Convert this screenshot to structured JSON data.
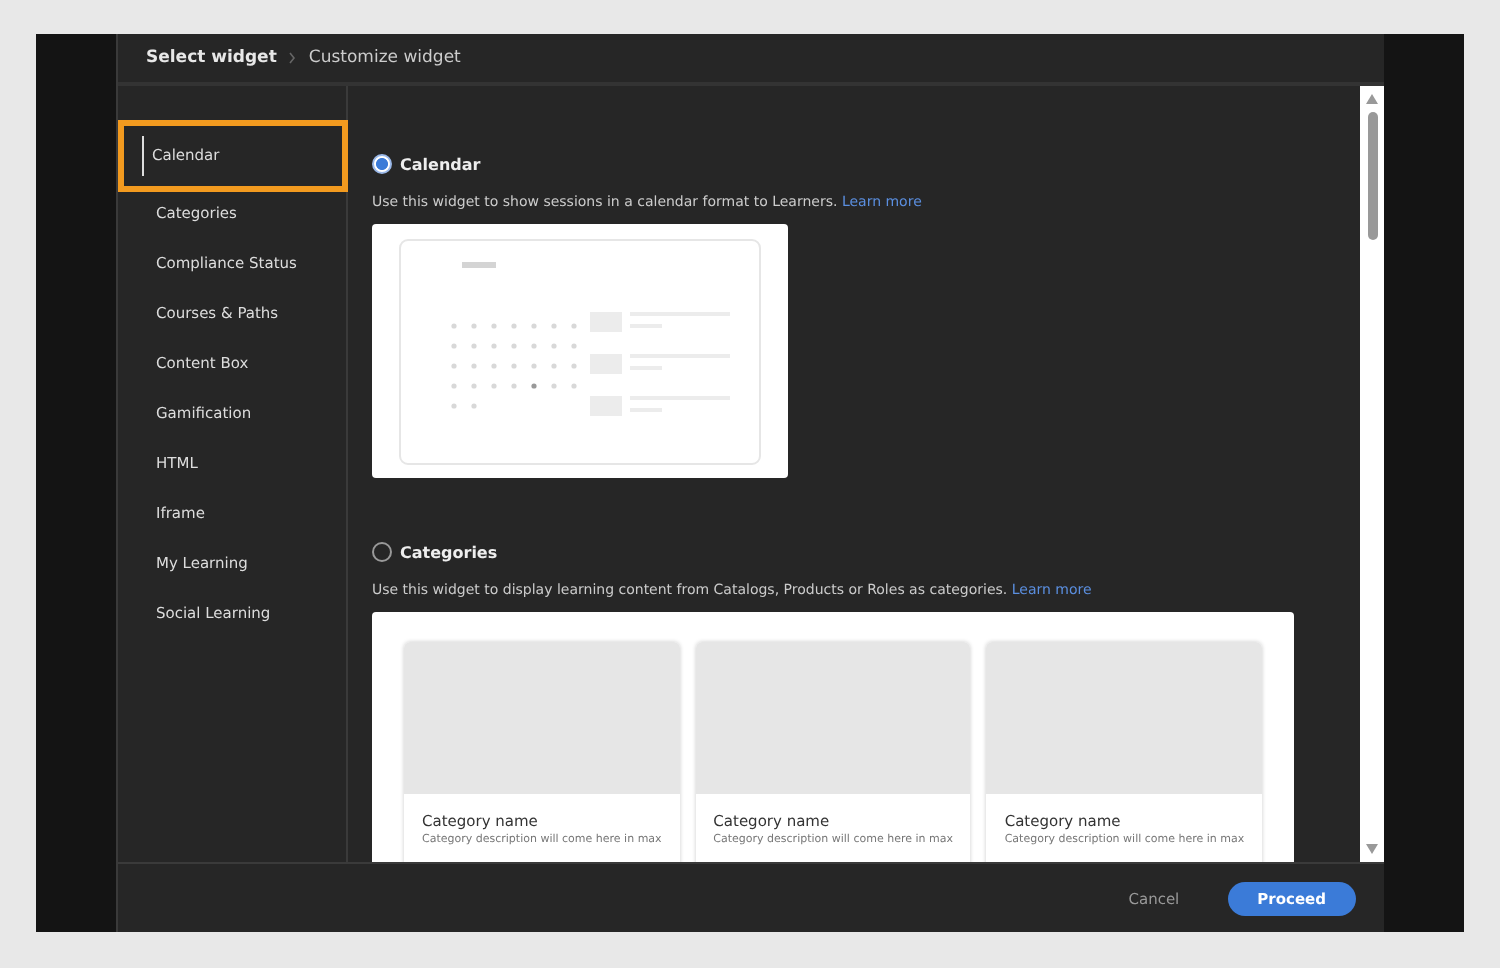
{
  "dialog": {
    "breadcrumb": [
      {
        "label": "Select widget",
        "selected": true
      },
      {
        "label": "Customize widget",
        "selected": false
      }
    ],
    "sidebar": {
      "items": [
        {
          "label": "Calendar",
          "selected": true
        },
        {
          "label": "Categories",
          "selected": false
        },
        {
          "label": "Compliance Status",
          "selected": false
        },
        {
          "label": "Courses & Paths",
          "selected": false
        },
        {
          "label": "Content Box",
          "selected": false
        },
        {
          "label": "Gamification",
          "selected": false
        },
        {
          "label": "HTML",
          "selected": false
        },
        {
          "label": "Iframe",
          "selected": false
        },
        {
          "label": "My Learning",
          "selected": false
        },
        {
          "label": "Social Learning",
          "selected": false
        }
      ]
    },
    "widgets": [
      {
        "kind": "calendar",
        "title": "Calendar",
        "selected": true,
        "description": "Use this widget to show sessions in a calendar format to Learners.",
        "link": "Learn more"
      },
      {
        "kind": "categories",
        "title": "Categories",
        "selected": false,
        "description": "Use this widget to display learning content from Catalogs, Products or Roles as categories.",
        "link": "Learn more",
        "cards": [
          {
            "name": "Category name",
            "description": "Category description will come here in max"
          },
          {
            "name": "Category name",
            "description": "Category description will come here in max"
          },
          {
            "name": "Category name",
            "description": "Category description will come here in max"
          }
        ]
      }
    ],
    "footer": {
      "buttons": [
        {
          "label": "Cancel",
          "kind": "secondary"
        },
        {
          "label": "Proceed",
          "kind": "primary"
        }
      ]
    }
  }
}
